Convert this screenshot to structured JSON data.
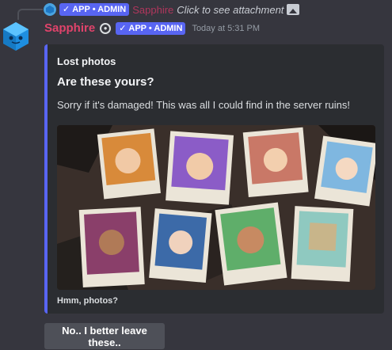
{
  "reply": {
    "badge": "APP • ADMIN",
    "author": "Sapphire",
    "text": "Click to see attachment",
    "icon": "image-icon"
  },
  "message": {
    "author": "Sapphire",
    "author_color": "#e0436b",
    "badge": "APP • ADMIN",
    "timestamp": "Today at 5:31 PM"
  },
  "embed": {
    "accent_color": "#5865f2",
    "author": "Lost photos",
    "title": "Are these yours?",
    "description": "Sorry if it's damaged! This was all I could find in the server ruins!",
    "image": "photos-collage",
    "footer": "Hmm, photos?"
  },
  "buttons": [
    {
      "label": "No.. I better leave these.."
    }
  ]
}
